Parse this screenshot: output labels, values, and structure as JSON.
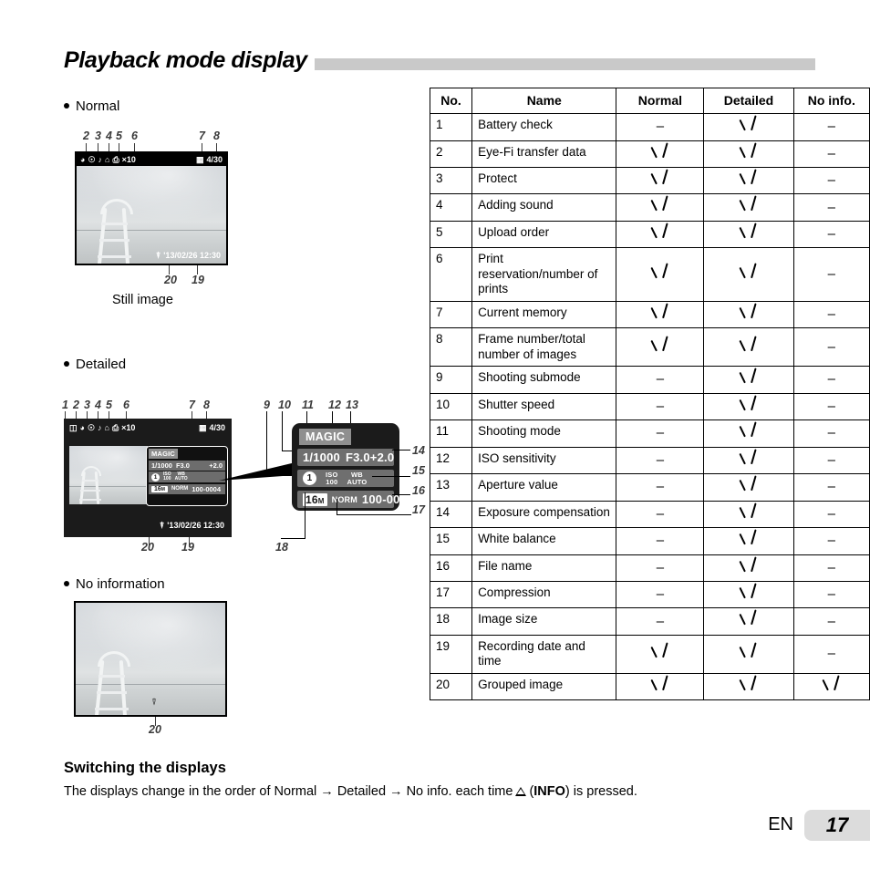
{
  "page": {
    "title": "Playback mode display",
    "language_code": "EN",
    "page_number": "17"
  },
  "sections": {
    "normal": {
      "label": "Normal",
      "caption": "Still image",
      "top_numbers": [
        "2",
        "3",
        "4",
        "5",
        "6"
      ],
      "top_right_numbers": [
        "7",
        "8"
      ],
      "bottom_numbers": [
        "20",
        "19"
      ],
      "osd": {
        "print_count": "×10",
        "frame": "4/30",
        "datetime": "'13/02/26  12:30"
      }
    },
    "detailed": {
      "label": "Detailed",
      "top_numbers": [
        "1",
        "2",
        "3",
        "4",
        "5",
        "6"
      ],
      "top_right_numbers": [
        "7",
        "8"
      ],
      "callout_numbers": [
        "9",
        "10",
        "11",
        "12",
        "13"
      ],
      "right_numbers": [
        "14",
        "15",
        "16",
        "17"
      ],
      "bottom_left_number": "18",
      "bottom_numbers": [
        "20",
        "19"
      ],
      "osd": {
        "print_count": "×10",
        "frame": "4/30",
        "datetime": "'13/02/26  12:30"
      },
      "info_panel": {
        "mode": "MAGIC",
        "shutter_speed": "1/1000",
        "aperture": "F3.0",
        "exposure_compensation": "+2.0",
        "submode_badge": "1",
        "iso_label": "ISO",
        "iso_value": "100",
        "wb_label": "WB",
        "wb_value": "AUTO",
        "image_size": "16",
        "image_size_unit": "M",
        "compression": "NORM",
        "file_name": "100-0004"
      }
    },
    "no_information": {
      "label": "No information",
      "bottom_number": "20"
    }
  },
  "table": {
    "headers": [
      "No.",
      "Name",
      "Normal",
      "Detailed",
      "No info."
    ],
    "mark_check": "check",
    "mark_none": "–",
    "rows": [
      {
        "no": "1",
        "name": "Battery check",
        "normal": "–",
        "detailed": "check",
        "noinfo": "–"
      },
      {
        "no": "2",
        "name": "Eye-Fi transfer data",
        "normal": "check",
        "detailed": "check",
        "noinfo": "–"
      },
      {
        "no": "3",
        "name": "Protect",
        "normal": "check",
        "detailed": "check",
        "noinfo": "–"
      },
      {
        "no": "4",
        "name": "Adding sound",
        "normal": "check",
        "detailed": "check",
        "noinfo": "–"
      },
      {
        "no": "5",
        "name": "Upload order",
        "normal": "check",
        "detailed": "check",
        "noinfo": "–"
      },
      {
        "no": "6",
        "name": "Print reservation/number of prints",
        "normal": "check",
        "detailed": "check",
        "noinfo": "–"
      },
      {
        "no": "7",
        "name": "Current memory",
        "normal": "check",
        "detailed": "check",
        "noinfo": "–"
      },
      {
        "no": "8",
        "name": "Frame number/total number of images",
        "normal": "check",
        "detailed": "check",
        "noinfo": "–"
      },
      {
        "no": "9",
        "name": "Shooting submode",
        "normal": "–",
        "detailed": "check",
        "noinfo": "–"
      },
      {
        "no": "10",
        "name": "Shutter speed",
        "normal": "–",
        "detailed": "check",
        "noinfo": "–"
      },
      {
        "no": "11",
        "name": "Shooting mode",
        "normal": "–",
        "detailed": "check",
        "noinfo": "–"
      },
      {
        "no": "12",
        "name": "ISO sensitivity",
        "normal": "–",
        "detailed": "check",
        "noinfo": "–"
      },
      {
        "no": "13",
        "name": "Aperture value",
        "normal": "–",
        "detailed": "check",
        "noinfo": "–"
      },
      {
        "no": "14",
        "name": "Exposure compensation",
        "normal": "–",
        "detailed": "check",
        "noinfo": "–"
      },
      {
        "no": "15",
        "name": "White balance",
        "normal": "–",
        "detailed": "check",
        "noinfo": "–"
      },
      {
        "no": "16",
        "name": "File name",
        "normal": "–",
        "detailed": "check",
        "noinfo": "–"
      },
      {
        "no": "17",
        "name": "Compression",
        "normal": "–",
        "detailed": "check",
        "noinfo": "–"
      },
      {
        "no": "18",
        "name": "Image size",
        "normal": "–",
        "detailed": "check",
        "noinfo": "–"
      },
      {
        "no": "19",
        "name": "Recording date and time",
        "normal": "check",
        "detailed": "check",
        "noinfo": "–"
      },
      {
        "no": "20",
        "name": "Grouped image",
        "normal": "check",
        "detailed": "check",
        "noinfo": "check"
      }
    ]
  },
  "footer": {
    "heading": "Switching the displays",
    "text_before": "The displays change in the order of Normal → Detailed → No info. each time",
    "info_button": "INFO",
    "text_after": ") is pressed.",
    "open_paren": "("
  }
}
